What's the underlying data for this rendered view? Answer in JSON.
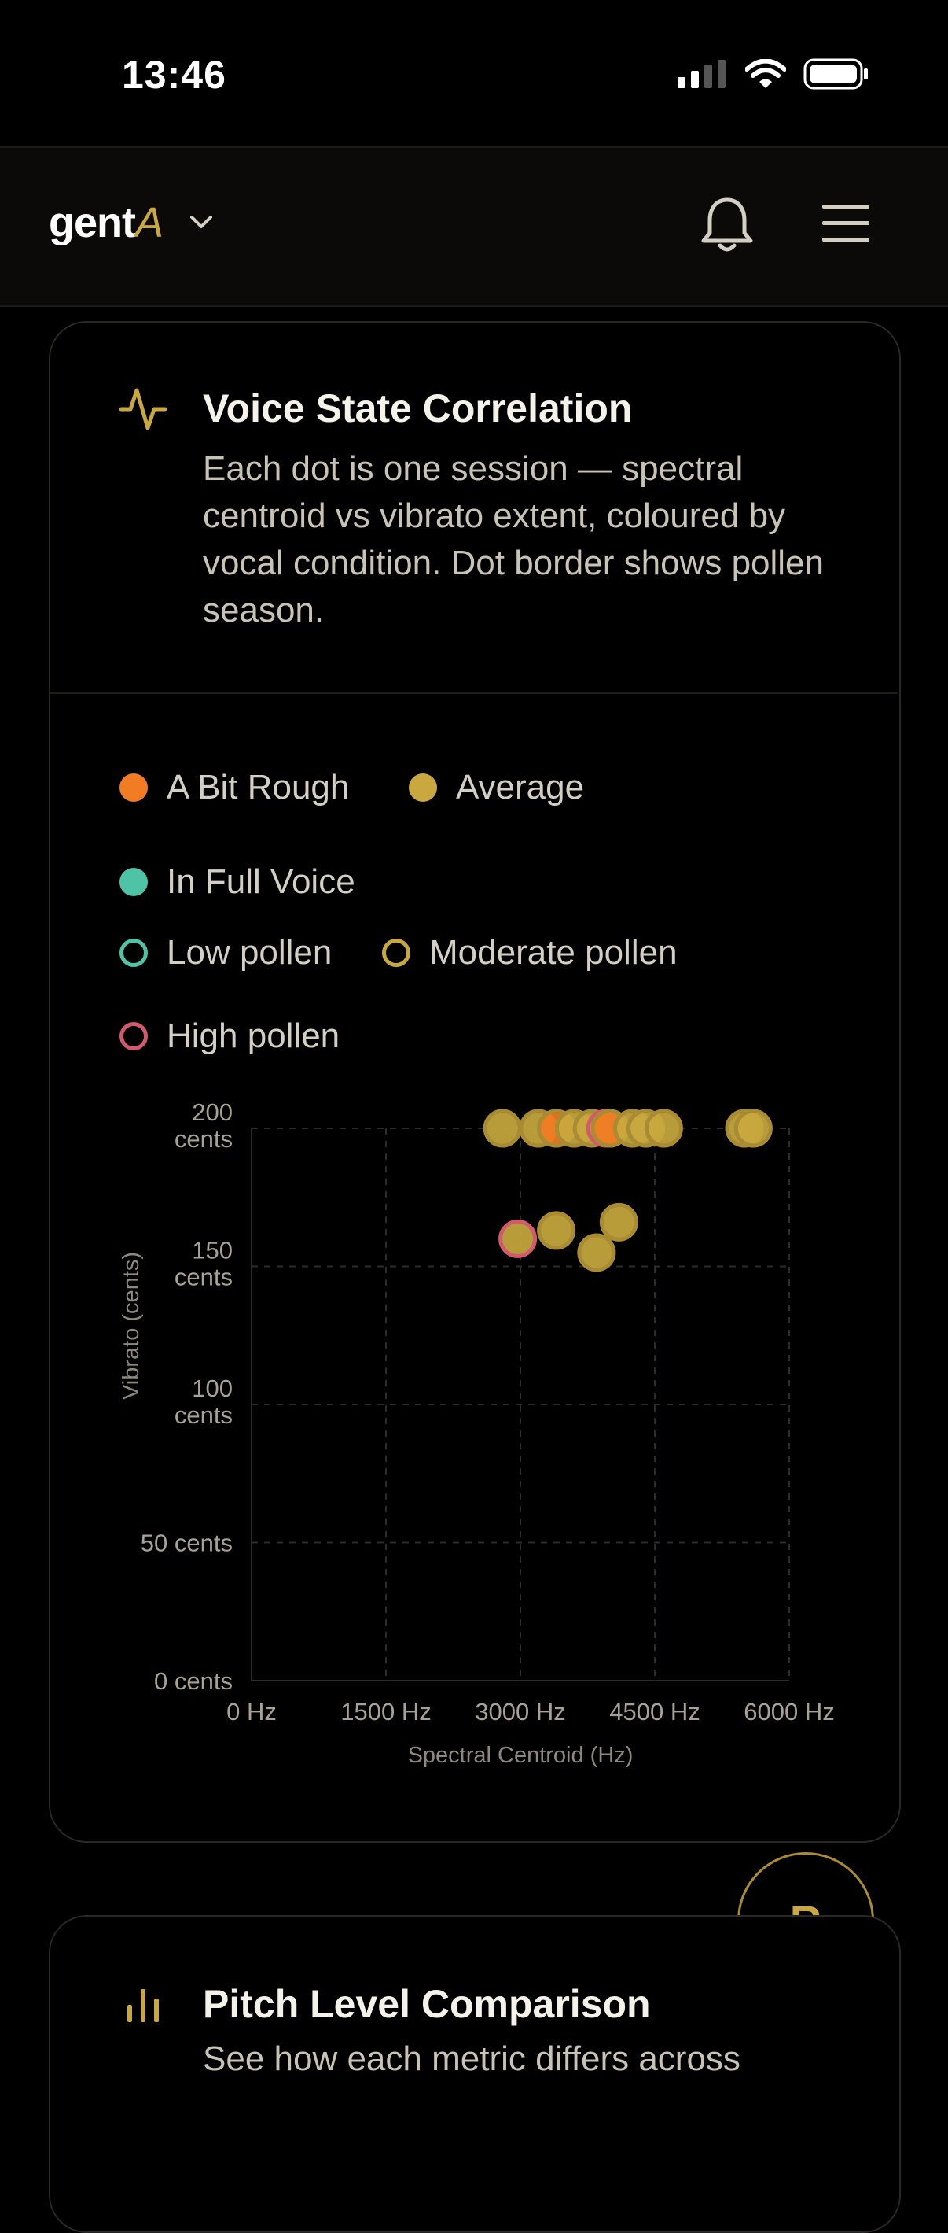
{
  "status": {
    "time": "13:46"
  },
  "header": {
    "logo_main": "gent",
    "logo_accent": "A"
  },
  "card": {
    "title": "Voice State Correlation",
    "description": "Each dot is one session — spectral centroid vs vibrato extent, coloured by vocal condition. Dot border shows pollen season."
  },
  "legend": {
    "conditions": [
      {
        "label": "A Bit Rough",
        "color": "#f27c23"
      },
      {
        "label": "Average",
        "color": "#c9a93f"
      },
      {
        "label": "In Full Voice",
        "color": "#4fc3a6"
      }
    ],
    "pollen": [
      {
        "label": "Low pollen",
        "color": "#4fc3a6"
      },
      {
        "label": "Moderate pollen",
        "color": "#c9a93f"
      },
      {
        "label": "High pollen",
        "color": "#d25a6e"
      }
    ]
  },
  "chart_data": {
    "type": "scatter",
    "xlabel": "Spectral Centroid (Hz)",
    "ylabel": "Vibrato (cents)",
    "xlim": [
      0,
      6000
    ],
    "ylim": [
      0,
      200
    ],
    "x_ticks": [
      "0 Hz",
      "1500 Hz",
      "3000 Hz",
      "4500 Hz",
      "6000 Hz"
    ],
    "y_ticks": [
      {
        "value": 200,
        "lines": [
          "200",
          "cents"
        ]
      },
      {
        "value": 150,
        "lines": [
          "150",
          "cents"
        ]
      },
      {
        "value": 100,
        "lines": [
          "100",
          "cents"
        ]
      },
      {
        "value": 50,
        "lines": [
          "50 cents"
        ]
      },
      {
        "value": 0,
        "lines": [
          "0 cents"
        ]
      }
    ],
    "grid": true,
    "points": [
      {
        "x": 2800,
        "y": 200,
        "condition": "Average",
        "pollen": "Moderate"
      },
      {
        "x": 3200,
        "y": 200,
        "condition": "Average",
        "pollen": "Moderate"
      },
      {
        "x": 3400,
        "y": 200,
        "condition": "A Bit Rough",
        "pollen": "Moderate"
      },
      {
        "x": 3600,
        "y": 200,
        "condition": "Average",
        "pollen": "Moderate"
      },
      {
        "x": 3800,
        "y": 200,
        "condition": "Average",
        "pollen": "Moderate"
      },
      {
        "x": 3950,
        "y": 200,
        "condition": "Average",
        "pollen": "High"
      },
      {
        "x": 4000,
        "y": 200,
        "condition": "A Bit Rough",
        "pollen": "Moderate"
      },
      {
        "x": 4250,
        "y": 200,
        "condition": "Average",
        "pollen": "Moderate"
      },
      {
        "x": 4400,
        "y": 200,
        "condition": "Average",
        "pollen": "Moderate"
      },
      {
        "x": 4600,
        "y": 200,
        "condition": "Average",
        "pollen": "Moderate"
      },
      {
        "x": 5500,
        "y": 200,
        "condition": "Average",
        "pollen": "Moderate"
      },
      {
        "x": 5600,
        "y": 200,
        "condition": "Average",
        "pollen": "Moderate"
      },
      {
        "x": 2970,
        "y": 160,
        "condition": "Average",
        "pollen": "High"
      },
      {
        "x": 3400,
        "y": 163,
        "condition": "Average",
        "pollen": "Moderate"
      },
      {
        "x": 3850,
        "y": 155,
        "condition": "Average",
        "pollen": "Moderate"
      },
      {
        "x": 4100,
        "y": 166,
        "condition": "Average",
        "pollen": "Moderate"
      }
    ]
  },
  "fab": {
    "label": "R"
  },
  "card2": {
    "title": "Pitch Level Comparison",
    "description": "See how each metric differs across"
  }
}
